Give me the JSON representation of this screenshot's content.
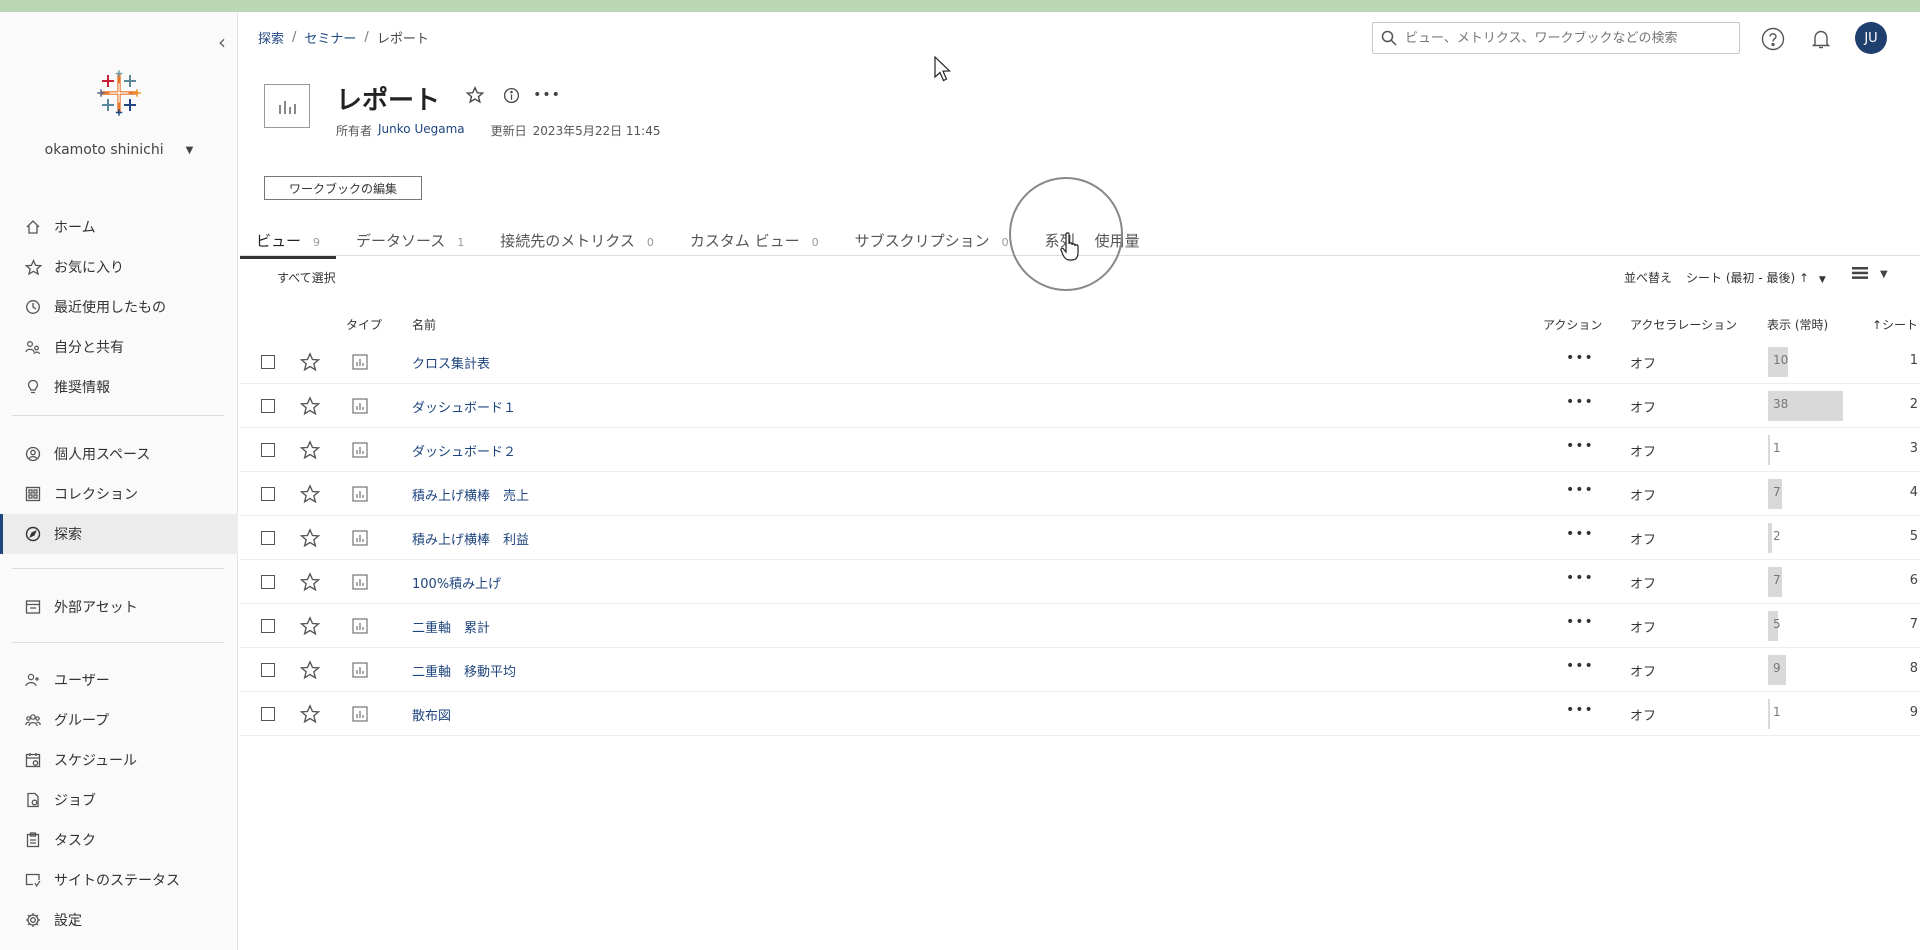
{
  "sidebar": {
    "user_name": "okamoto shinichi",
    "items": [
      {
        "label": "ホーム",
        "icon": "home-icon"
      },
      {
        "label": "お気に入り",
        "icon": "star-icon"
      },
      {
        "label": "最近使用したもの",
        "icon": "clock-icon"
      },
      {
        "label": "自分と共有",
        "icon": "shared-icon"
      },
      {
        "label": "推奨情報",
        "icon": "lightbulb-icon"
      },
      {
        "label": "個人用スペース",
        "icon": "personal-space-icon"
      },
      {
        "label": "コレクション",
        "icon": "collection-icon"
      },
      {
        "label": "探索",
        "icon": "explore-icon"
      },
      {
        "label": "外部アセット",
        "icon": "external-assets-icon"
      },
      {
        "label": "ユーザー",
        "icon": "user-icon"
      },
      {
        "label": "グループ",
        "icon": "group-icon"
      },
      {
        "label": "スケジュール",
        "icon": "schedule-icon"
      },
      {
        "label": "ジョブ",
        "icon": "job-icon"
      },
      {
        "label": "タスク",
        "icon": "task-icon"
      },
      {
        "label": "サイトのステータス",
        "icon": "site-status-icon"
      },
      {
        "label": "設定",
        "icon": "settings-icon"
      }
    ]
  },
  "breadcrumb": {
    "items": [
      "探索",
      "セミナー"
    ],
    "current": "レポート"
  },
  "search": {
    "placeholder": "ビュー、メトリクス、ワークブックなどの検索"
  },
  "avatar": {
    "initials": "JU",
    "color": "#1f3f6e"
  },
  "workbook": {
    "title": "レポート",
    "owner_label": "所有者",
    "owner": "Junko Uegama",
    "updated_label": "更新日",
    "updated": "2023年5月22日 11:45",
    "edit_button": "ワークブックの編集"
  },
  "tabs": [
    {
      "label": "ビュー",
      "count": "9"
    },
    {
      "label": "データソース",
      "count": "1"
    },
    {
      "label": "接続先のメトリクス",
      "count": "0"
    },
    {
      "label": "カスタム ビュー",
      "count": "0"
    },
    {
      "label": "サブスクリプション",
      "count": "0"
    },
    {
      "label": "系列",
      "count": ""
    },
    {
      "label": "使用量",
      "count": ""
    }
  ],
  "toolbar": {
    "select_all": "すべて選択",
    "sort_label": "並べ替え",
    "sort_value": "シート (最初 - 最後) ↑"
  },
  "table": {
    "headers": {
      "type": "タイプ",
      "name": "名前",
      "actions": "アクション",
      "acceleration": "アクセラレーション",
      "views": "表示 (常時)",
      "sheet": "↑シート"
    },
    "rows": [
      {
        "name": "クロス集計表",
        "acceleration": "オフ",
        "views": 10,
        "sheet": "1"
      },
      {
        "name": "ダッシュボード１",
        "acceleration": "オフ",
        "views": 38,
        "sheet": "2"
      },
      {
        "name": "ダッシュボード２",
        "acceleration": "オフ",
        "views": 1,
        "sheet": "3"
      },
      {
        "name": "積み上げ横棒　売上",
        "acceleration": "オフ",
        "views": 7,
        "sheet": "4"
      },
      {
        "name": "積み上げ横棒　利益",
        "acceleration": "オフ",
        "views": 2,
        "sheet": "5"
      },
      {
        "name": "100%積み上げ",
        "acceleration": "オフ",
        "views": 7,
        "sheet": "6"
      },
      {
        "name": "二重軸　累計",
        "acceleration": "オフ",
        "views": 5,
        "sheet": "7"
      },
      {
        "name": "二重軸　移動平均",
        "acceleration": "オフ",
        "views": 9,
        "sheet": "8"
      },
      {
        "name": "散布図",
        "acceleration": "オフ",
        "views": 1,
        "sheet": "9"
      }
    ],
    "actions_glyph": "•••"
  },
  "colors": {
    "accent": "#1f457e",
    "bar": "#d9d9d9"
  }
}
